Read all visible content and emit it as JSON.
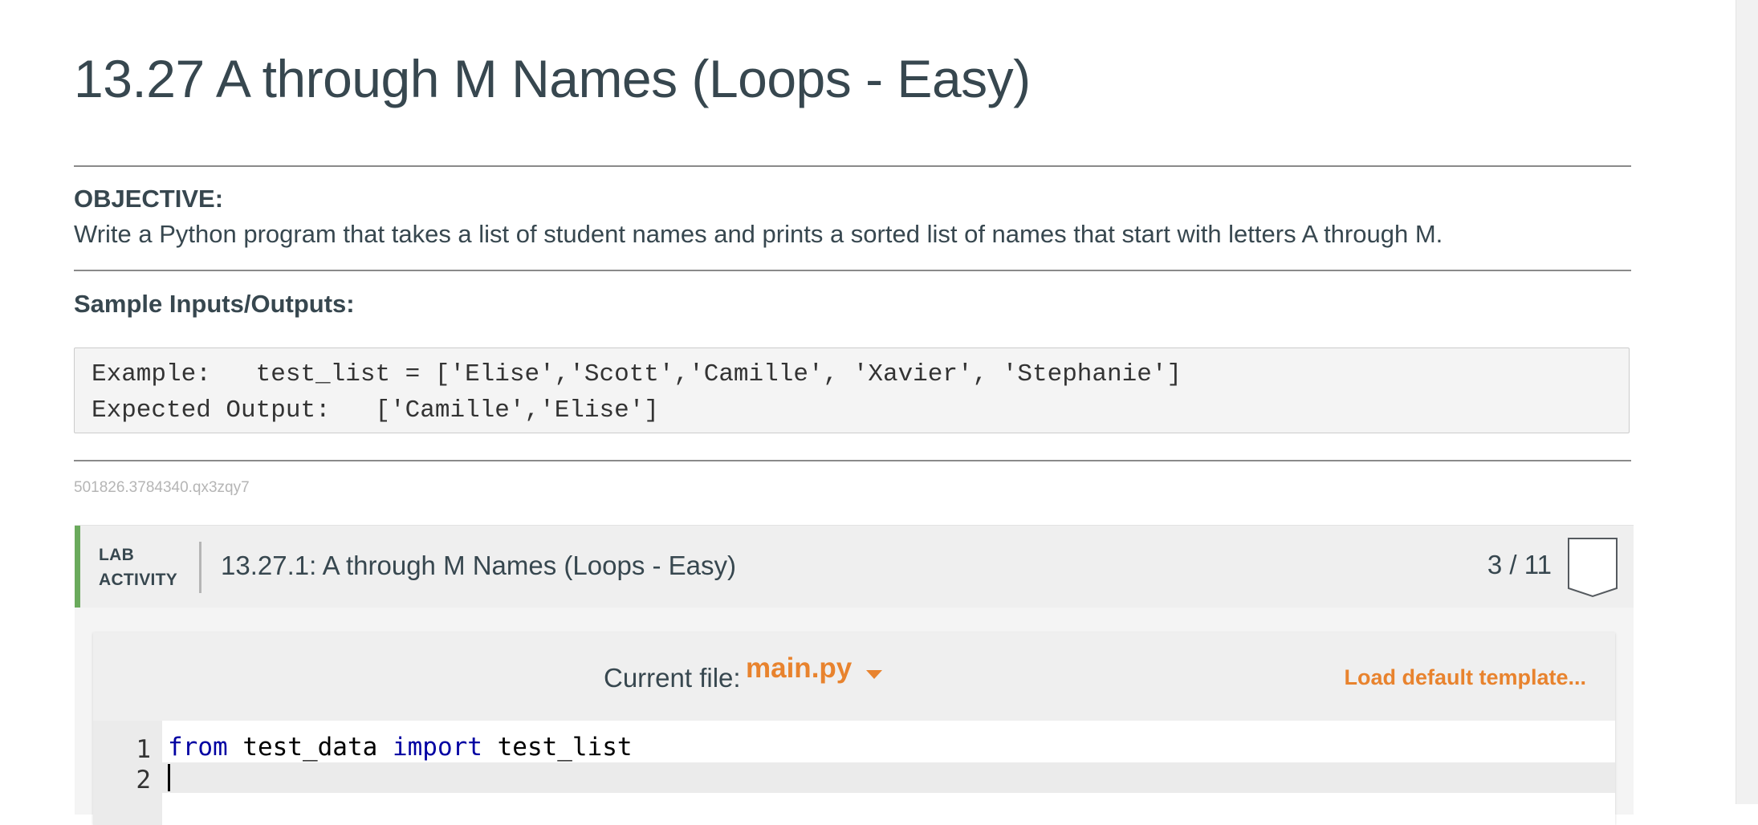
{
  "page": {
    "title": "13.27 A through M Names (Loops - Easy)"
  },
  "objective": {
    "heading": "OBJECTIVE:",
    "text": "Write a Python program that takes a list of student names and prints a sorted list of names that start with letters A through M."
  },
  "samples": {
    "heading": "Sample Inputs/Outputs:",
    "lines": [
      "Example:   test_list = ['Elise','Scott','Camille', 'Xavier', 'Stephanie']",
      "Expected Output:   ['Camille','Elise']"
    ]
  },
  "zyid": "501826.3784340.qx3zqy7",
  "lab": {
    "badge_line1": "LAB",
    "badge_line2": "ACTIVITY",
    "title": "13.27.1: A through M Names (Loops - Easy)",
    "score": "3 / 11",
    "accent_color": "#6aaa5c"
  },
  "editor": {
    "current_file_label": "Current file:",
    "current_file": "main.py",
    "load_template_label": "Load default template...",
    "accent_color": "#e8832e",
    "lines": [
      {
        "number": "1",
        "kw1": "from",
        "t1": " test_data ",
        "kw2": "import",
        "t2": " test_list"
      },
      {
        "number": "2"
      }
    ]
  }
}
